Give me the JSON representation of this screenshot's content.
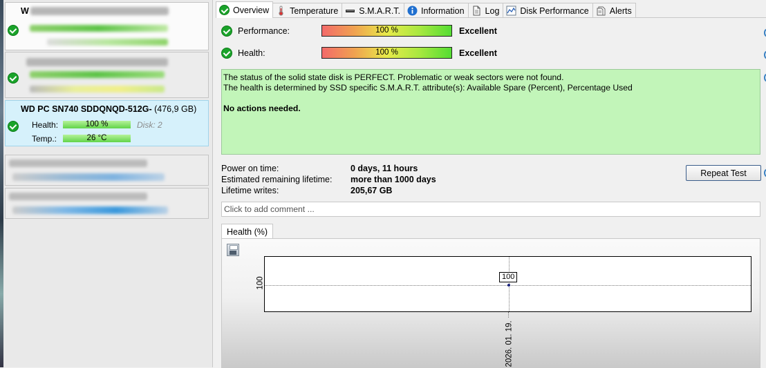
{
  "left_panel": {
    "disks": [
      {
        "title": "W",
        "state": "obscured"
      },
      {
        "title": "",
        "state": "obscured"
      },
      {
        "title": "WD PC SN740 SDDQNQD-512G-",
        "size": "(476,9 GB)",
        "health_label": "Health:",
        "health_value": "100 %",
        "disk_label": "Disk: 2",
        "temp_label": "Temp.:",
        "temp_value": "26 °C",
        "state": "selected"
      },
      {
        "title": "",
        "state": "obscured"
      },
      {
        "title": "",
        "state": "obscured"
      }
    ]
  },
  "tabs": [
    {
      "label": "Overview",
      "icon": "check-icon"
    },
    {
      "label": "Temperature",
      "icon": "thermometer-icon"
    },
    {
      "label": "S.M.A.R.T.",
      "icon": "smart-chip-icon"
    },
    {
      "label": "Information",
      "icon": "info-icon"
    },
    {
      "label": "Log",
      "icon": "document-icon"
    },
    {
      "label": "Disk Performance",
      "icon": "graph-icon"
    },
    {
      "label": "Alerts",
      "icon": "alerts-icon"
    }
  ],
  "overview": {
    "performance": {
      "label": "Performance:",
      "value": "100 %",
      "fill": 1.0,
      "verdict": "Excellent"
    },
    "health": {
      "label": "Health:",
      "value": "100 %",
      "fill": 1.0,
      "verdict": "Excellent"
    },
    "status_lines": [
      "The status of the solid state disk is PERFECT. Problematic or weak sectors were not found.",
      "The health is determined by SSD specific S.M.A.R.T. attribute(s):  Available Spare (Percent), Percentage Used"
    ],
    "status_action": "No actions needed.",
    "info": [
      {
        "label": "Power on time:",
        "value": "0 days, 11 hours"
      },
      {
        "label": "Estimated remaining lifetime:",
        "value": "more than 1000 days"
      },
      {
        "label": "Lifetime writes:",
        "value": "205,67 GB"
      }
    ],
    "repeat_test": "Repeat Test",
    "comment_placeholder": "Click to add comment ..."
  },
  "chart_tab": "Health (%)",
  "chart_data": {
    "type": "line",
    "x": [
      "2026. 01. 19."
    ],
    "series": [
      {
        "values": [
          100
        ]
      }
    ],
    "y_tick_labels": [
      "100"
    ],
    "x_tick_labels": [
      "2026. 01. 19."
    ],
    "data_labels": [
      "100"
    ],
    "grid": true
  },
  "colors": {
    "good": "#1aa32a",
    "status_bg": "#c2f5b9",
    "selected_bg": "#d6f1fb",
    "marker": "#1a237e"
  }
}
